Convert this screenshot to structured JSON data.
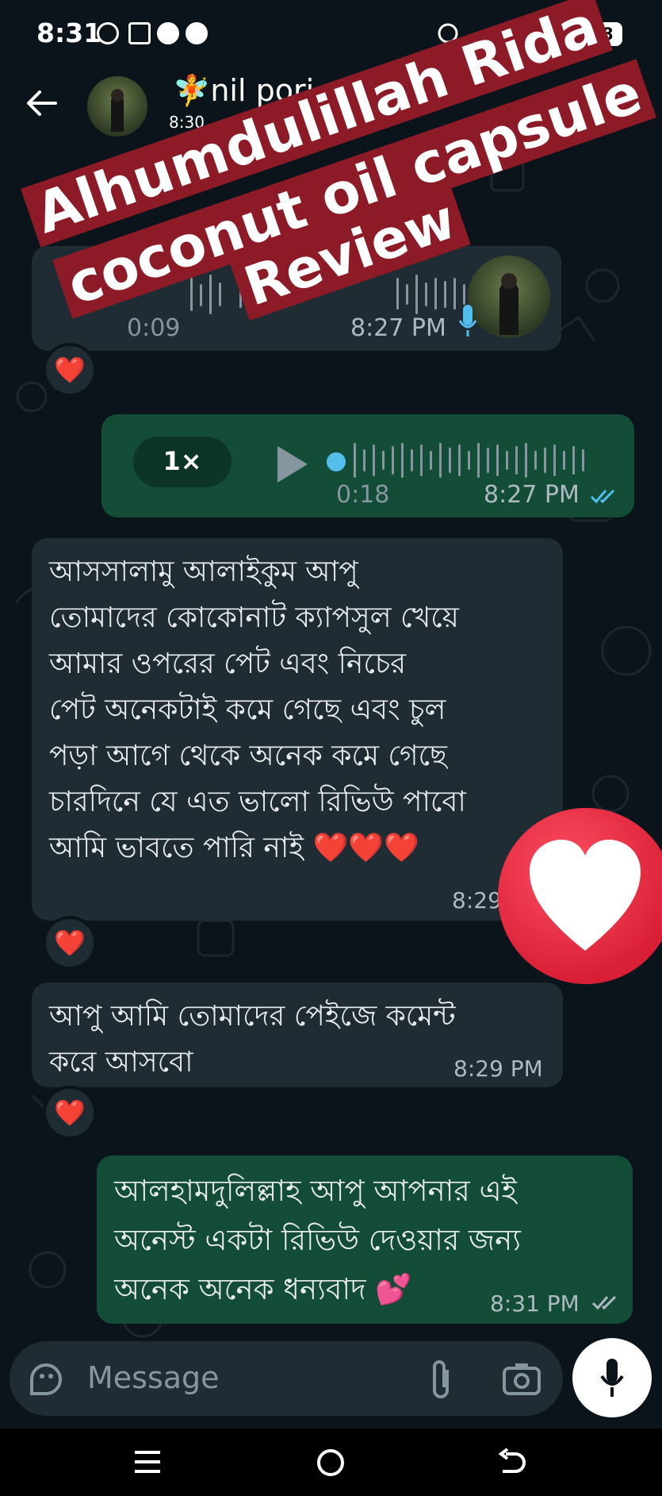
{
  "status_bar": {
    "time": "8:31",
    "battery": "48"
  },
  "header": {
    "contact_name": "🧚nil pori",
    "contact_sub": "8:30"
  },
  "banner": {
    "line1": "Alhumdulillah Rida",
    "line2": "coconut oil capsule",
    "line3": "Review"
  },
  "messages": [
    {
      "type": "voice",
      "direction": "incoming",
      "duration": "0:09",
      "time": "8:27 PM",
      "reaction": "❤️"
    },
    {
      "type": "voice",
      "direction": "outgoing",
      "speed": "1×",
      "duration": "0:18",
      "time": "8:27 PM",
      "status": "read"
    },
    {
      "type": "text",
      "direction": "incoming",
      "text": "আসসালামু আলাইকুম আপু\nতোমাদের কোকোনাট ক্যাপসুল খেয়ে\nআমার ওপরের পেট এবং নিচের\nপেট অনেকটাই কমে গেছে এবং চুল\nপড়া আগে থেকে অনেক কমে গেছে\nচারদিনে যে এত ভালো রিভিউ পাবো\nআমি ভাবতে পারি নাই ❤️❤️❤️",
      "time": "8:29",
      "reaction": "❤️"
    },
    {
      "type": "text",
      "direction": "incoming",
      "text": "আপু আমি তোমাদের পেইজে কমেন্ট\nকরে আসবো",
      "time": "8:29 PM",
      "reaction": "❤️"
    },
    {
      "type": "text",
      "direction": "outgoing",
      "text": "আলহামদুলিল্লাহ আপু আপনার এই\nঅনেস্ট একটা রিভিউ দেওয়ার জন্য\nঅনেক অনেক ধন্যবাদ 💕",
      "time": "8:31 PM",
      "status": "read"
    }
  ],
  "composer": {
    "placeholder": "Message"
  },
  "icons": [
    "back-arrow-icon",
    "kebab-menu-icon",
    "play-icon",
    "mic-icon",
    "sticker-icon",
    "attach-icon",
    "camera-icon",
    "read-ticks-icon",
    "heart-overlay-icon",
    "nav-menu-icon",
    "nav-home-icon",
    "nav-back-icon"
  ],
  "colors": {
    "background": "#0b141a",
    "incoming_bubble": "#1f2c33",
    "outgoing_bubble": "#144d37",
    "banner": "#8c1a27",
    "read_tick": "#53bdeb",
    "heart_badge": "#e8263d"
  }
}
